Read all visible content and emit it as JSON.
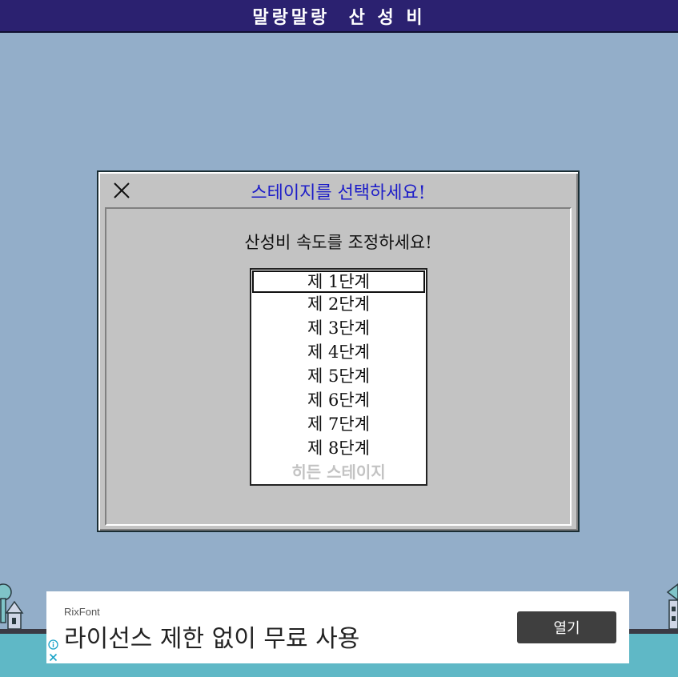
{
  "app": {
    "title": "말랑말랑  산 성 비"
  },
  "dialog": {
    "title": "스테이지를 선택하세요!",
    "close_icon": "close-icon",
    "prompt": "산성비 속도를 조정하세요!",
    "stages": [
      {
        "label": "제 1단계",
        "selected": true,
        "enabled": true
      },
      {
        "label": "제 2단계",
        "selected": false,
        "enabled": true
      },
      {
        "label": "제 3단계",
        "selected": false,
        "enabled": true
      },
      {
        "label": "제 4단계",
        "selected": false,
        "enabled": true
      },
      {
        "label": "제 5단계",
        "selected": false,
        "enabled": true
      },
      {
        "label": "제 6단계",
        "selected": false,
        "enabled": true
      },
      {
        "label": "제 7단계",
        "selected": false,
        "enabled": true
      },
      {
        "label": "제 8단계",
        "selected": false,
        "enabled": true
      },
      {
        "label": "히든 스테이지",
        "selected": false,
        "enabled": false
      }
    ]
  },
  "ad": {
    "brand": "RixFont",
    "headline": "라이선스 제한 없이 무료 사용",
    "open_label": "열기",
    "info_icon": "info-icon",
    "close_icon": "close-icon"
  },
  "colors": {
    "background": "#93aec9",
    "title_bar": "#2b2170",
    "dialog_title": "#1c1cc8",
    "dialog_face": "#c3c3c3",
    "ad_button": "#3f3f3f",
    "water": "#5fb8c6"
  }
}
